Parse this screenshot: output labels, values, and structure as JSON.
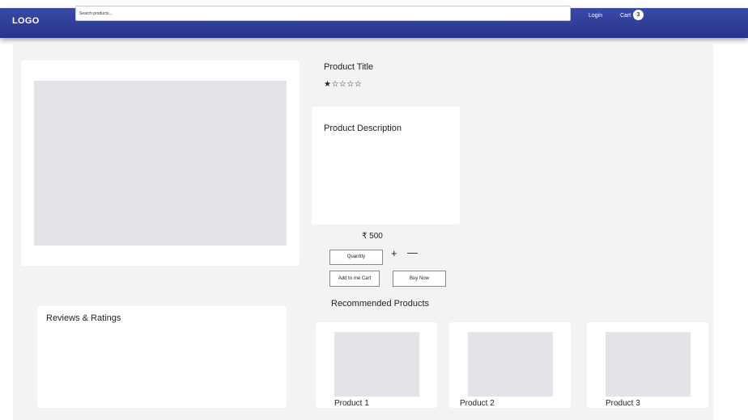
{
  "header": {
    "logo": "LOGO",
    "search_placeholder": "Search products...",
    "login_label": "Login",
    "cart_label": "Cart",
    "cart_count": "3"
  },
  "product": {
    "title": "Product Title",
    "rating_stars": "★☆☆☆☆",
    "rating_value": 1,
    "rating_max": 5,
    "description_label": "Product Description",
    "price": "₹ 500",
    "quantity_placeholder": "Quantity",
    "plus_label": "+",
    "minus_label": "—",
    "add_to_cart_label": "Add to me Cart",
    "buy_now_label": "Buy Now"
  },
  "reviews": {
    "title": "Reviews & Ratings"
  },
  "recommended": {
    "title": "Recommended Products",
    "items": [
      {
        "name": "Product 1"
      },
      {
        "name": "Product 2"
      },
      {
        "name": "Product 3"
      }
    ]
  },
  "colors": {
    "header_bg": "#27348b",
    "page_bg": "#f2f3f5",
    "placeholder": "#e3e4e8"
  }
}
